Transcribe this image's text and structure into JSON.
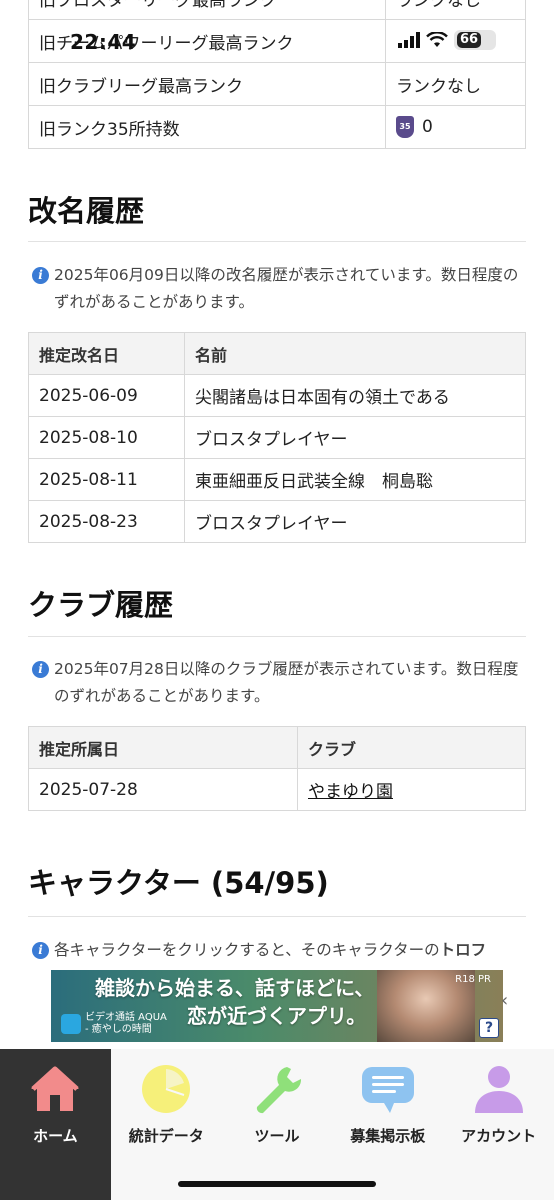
{
  "status_bar": {
    "time": "22:44",
    "battery": "66"
  },
  "rank_rows": [
    {
      "label": "旧ブロスターリーグ最高ランク",
      "value": "ランクなし"
    },
    {
      "label": "旧チームパワーリーグ最高ランク",
      "value": ""
    },
    {
      "label": "旧クラブリーグ最高ランク",
      "value": "ランクなし"
    },
    {
      "label": "旧ランク35所持数",
      "value": "0",
      "badge": "35"
    }
  ],
  "rename": {
    "title": "改名履歴",
    "note": "2025年06月09日以降の改名履歴が表示されています。数日程度のずれがあることがあります。",
    "headers": [
      "推定改名日",
      "名前"
    ],
    "rows": [
      [
        "2025-06-09",
        "尖閣諸島は日本固有の領土である"
      ],
      [
        "2025-08-10",
        "ブロスタプレイヤー"
      ],
      [
        "2025-08-11",
        "東亜細亜反日武装全線　桐島聡"
      ],
      [
        "2025-08-23",
        "ブロスタプレイヤー"
      ]
    ]
  },
  "club": {
    "title": "クラブ履歴",
    "note": "2025年07月28日以降のクラブ履歴が表示されています。数日程度のずれがあることがあります。",
    "headers": [
      "推定所属日",
      "クラブ"
    ],
    "rows": [
      [
        "2025-07-28",
        "やまゆり園"
      ]
    ]
  },
  "character": {
    "title": "キャラクター (54/95)",
    "note_prefix": "各キャラクターをクリックすると、そのキャラクターの",
    "note_bold": "トロフ"
  },
  "ad": {
    "line1": "雑談から始まる、話すほどに、",
    "line2": "恋が近づくアプリ。",
    "brand": "ビデオ通話 AQUA",
    "brand_sub": "- 癒やしの時間",
    "rating": "R18  PR",
    "help": "?"
  },
  "nav": [
    {
      "label": "ホーム",
      "icon": "home-icon",
      "color": "#f28b8b"
    },
    {
      "label": "統計データ",
      "icon": "pie-chart-icon",
      "color": "#f6f07a"
    },
    {
      "label": "ツール",
      "icon": "wrench-icon",
      "color": "#8fe07a"
    },
    {
      "label": "募集掲示板",
      "icon": "chat-bubble-icon",
      "color": "#8ec3f0"
    },
    {
      "label": "アカウント",
      "icon": "account-icon",
      "color": "#c79be8"
    }
  ]
}
